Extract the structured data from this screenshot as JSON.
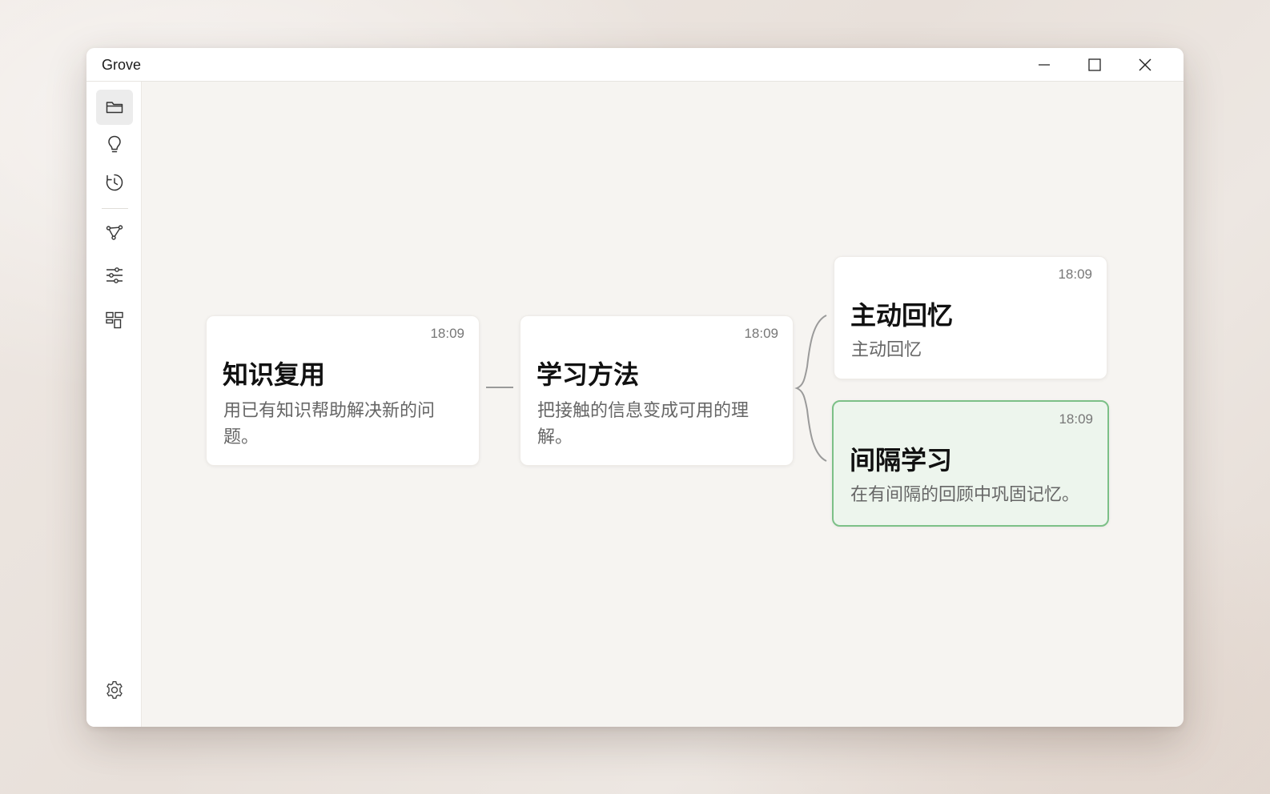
{
  "window": {
    "title": "Grove"
  },
  "sidebar": {
    "items": [
      {
        "name": "folder",
        "icon": "folder-icon",
        "active": true
      },
      {
        "name": "ideas",
        "icon": "lightbulb-icon",
        "active": false
      },
      {
        "name": "history",
        "icon": "history-icon",
        "active": false
      },
      {
        "name": "graph",
        "icon": "graph-nodes-icon",
        "active": false
      },
      {
        "name": "filters",
        "icon": "sliders-icon",
        "active": false
      },
      {
        "name": "layout",
        "icon": "layout-blocks-icon",
        "active": false
      }
    ],
    "settings_icon": "gear-icon"
  },
  "cards": [
    {
      "id": "knowledge-reuse",
      "time": "18:09",
      "title": "知识复用",
      "body": "用已有知识帮助解决新的问题。"
    },
    {
      "id": "learning-methods",
      "time": "18:09",
      "title": "学习方法",
      "body": "把接触的信息变成可用的理解。"
    },
    {
      "id": "active-recall",
      "time": "18:09",
      "title": "主动回忆",
      "body": "主动回忆"
    },
    {
      "id": "spaced-learning",
      "time": "18:09",
      "title": "间隔学习",
      "body": "在有间隔的回顾中巩固记忆。",
      "selected": true
    }
  ],
  "colors": {
    "accent": "#7cc087",
    "selected_bg": "#edf5ed",
    "connector": "#9a9a9a"
  }
}
